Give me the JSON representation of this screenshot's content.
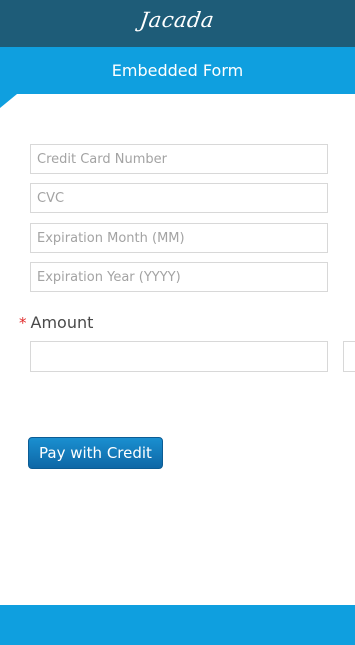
{
  "header": {
    "logo_text": "Jacada",
    "colors": {
      "top_bar": "#1e5c78",
      "accent": "#0f9fdf"
    }
  },
  "form": {
    "title": "Embedded Form",
    "fields": {
      "credit_card_number": {
        "placeholder": "Credit Card Number",
        "value": ""
      },
      "cvc": {
        "placeholder": "CVC",
        "value": ""
      },
      "expiration_month": {
        "placeholder": "Expiration Month (MM)",
        "value": ""
      },
      "expiration_year": {
        "placeholder": "Expiration Year (YYYY)",
        "value": ""
      }
    },
    "amount": {
      "required_marker": "*",
      "label": "Amount",
      "value": ""
    },
    "pay_button_label": "Pay with Credit"
  }
}
